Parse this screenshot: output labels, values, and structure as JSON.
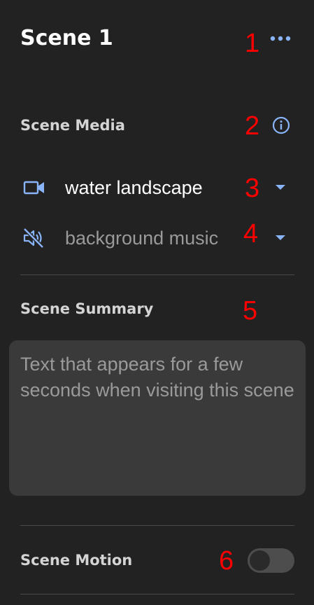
{
  "header": {
    "title": "Scene 1",
    "menu_icon": "more-horizontal-icon"
  },
  "annotations": [
    "1",
    "2",
    "3",
    "4",
    "5",
    "6"
  ],
  "scene_media": {
    "label": "Scene Media",
    "info_icon": "info-circle-icon",
    "video": {
      "label": "water landscape",
      "icon": "videocam-icon",
      "selected": true
    },
    "audio": {
      "label": "background music",
      "icon": "volume-off-icon",
      "selected": false
    },
    "dropdown_icon": "caret-down-icon"
  },
  "scene_summary": {
    "label": "Scene Summary",
    "placeholder": "Text that appears for a few seconds when visiting this scene"
  },
  "scene_motion": {
    "label": "Scene Motion",
    "enabled": false
  },
  "colors": {
    "background": "#222222",
    "accent": "#8ab4f8",
    "annotation": "#ff0000",
    "input_bg": "#3a3a3a"
  }
}
